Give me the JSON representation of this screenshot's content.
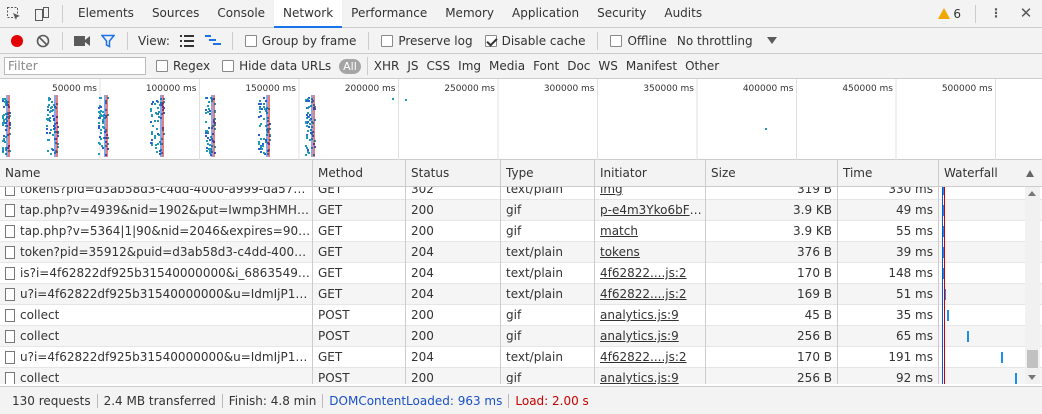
{
  "tabbar": {
    "tabs": [
      {
        "label": "Elements"
      },
      {
        "label": "Sources"
      },
      {
        "label": "Console"
      },
      {
        "label": "Network"
      },
      {
        "label": "Performance"
      },
      {
        "label": "Memory"
      },
      {
        "label": "Application"
      },
      {
        "label": "Security"
      },
      {
        "label": "Audits"
      }
    ],
    "active_tab": "Network",
    "warning_count": "6"
  },
  "toolbar": {
    "view_label": "View:",
    "group_by_frame": "Group by frame",
    "preserve_log": "Preserve log",
    "disable_cache": "Disable cache",
    "offline": "Offline",
    "throttling": "No throttling"
  },
  "filterbar": {
    "placeholder": "Filter",
    "regex": "Regex",
    "hide_data_urls": "Hide data URLs",
    "all": "All",
    "types": [
      "XHR",
      "JS",
      "CSS",
      "Img",
      "Media",
      "Font",
      "Doc",
      "WS",
      "Manifest",
      "Other"
    ]
  },
  "overview": {
    "ticks": [
      "50000 ms",
      "100000 ms",
      "150000 ms",
      "200000 ms",
      "250000 ms",
      "300000 ms",
      "350000 ms",
      "400000 ms",
      "450000 ms",
      "500000 ms"
    ]
  },
  "table": {
    "headers": {
      "name": "Name",
      "method": "Method",
      "status": "Status",
      "type": "Type",
      "initiator": "Initiator",
      "size": "Size",
      "time": "Time",
      "waterfall": "Waterfall"
    },
    "rows": [
      {
        "name": "tokens?pid=d3ab58d3-c4dd-4000-a999-da578f7dd...",
        "method": "GET",
        "status": "302",
        "type": "text/plain",
        "initiator": "img",
        "size": "319 B",
        "time": "330 ms",
        "wf": 0.002
      },
      {
        "name": "tap.php?v=4939&nid=1902&put=Iwmp3HMH_487...",
        "method": "GET",
        "status": "200",
        "type": "gif",
        "initiator": "p-e4m3Yko6bFY...",
        "size": "3.9 KB",
        "time": "49 ms",
        "wf": 0.004
      },
      {
        "name": "tap.php?v=5364|1|90&nid=2046&expires=90&put=...",
        "method": "GET",
        "status": "200",
        "type": "gif",
        "initiator": "match",
        "size": "3.9 KB",
        "time": "55 ms",
        "wf": 0.004
      },
      {
        "name": "token?pid=35912&puid=d3ab58d3-c4dd-4000-a99...",
        "method": "GET",
        "status": "204",
        "type": "text/plain",
        "initiator": "tokens",
        "size": "376 B",
        "time": "39 ms",
        "wf": 0.006
      },
      {
        "name": "is?i=4f62822df925b31540000000&i_68635496=7.6...",
        "method": "GET",
        "status": "204",
        "type": "text/plain",
        "initiator": "4f62822....js:2",
        "size": "170 B",
        "time": "148 ms",
        "wf": 0.006
      },
      {
        "name": "u?i=4f62822df925b31540000000&u=IdmIjP1oEE&u...",
        "method": "GET",
        "status": "204",
        "type": "text/plain",
        "initiator": "4f62822....js:2",
        "size": "169 B",
        "time": "51 ms",
        "wf": 0.008
      },
      {
        "name": "collect",
        "method": "POST",
        "status": "200",
        "type": "gif",
        "initiator": "analytics.js:9",
        "size": "45 B",
        "time": "35 ms",
        "wf": 0.05
      },
      {
        "name": "collect",
        "method": "POST",
        "status": "200",
        "type": "gif",
        "initiator": "analytics.js:9",
        "size": "256 B",
        "time": "65 ms",
        "wf": 0.3
      },
      {
        "name": "u?i=4f62822df925b31540000000&u=IdmIjP1oEE&u...",
        "method": "GET",
        "status": "204",
        "type": "text/plain",
        "initiator": "4f62822....js:2",
        "size": "170 B",
        "time": "191 ms",
        "wf": 0.72
      },
      {
        "name": "collect",
        "method": "POST",
        "status": "200",
        "type": "gif",
        "initiator": "analytics.js:9",
        "size": "256 B",
        "time": "92 ms",
        "wf": 0.9
      }
    ]
  },
  "statusbar": {
    "requests": "130 requests",
    "transferred": "2.4 MB transferred",
    "finish": "Finish: 4.8 min",
    "dcl": "DOMContentLoaded: 963 ms",
    "load": "Load: 2.00 s"
  },
  "colors": {
    "accent": "#1a73e8",
    "record": "#e30000",
    "dcl_line": "#1a50c8",
    "load_line": "#c80000",
    "waterfall_bar": "#1f8ee8"
  },
  "icons": [
    "inspect-icon",
    "device-toolbar-icon",
    "warning-icon",
    "kebab-menu-icon",
    "close-icon",
    "record-icon",
    "clear-icon",
    "camera-icon",
    "filter-icon",
    "large-rows-icon",
    "overview-icon",
    "throttle-dropdown-icon",
    "file-icon",
    "sort-ascending-icon"
  ]
}
